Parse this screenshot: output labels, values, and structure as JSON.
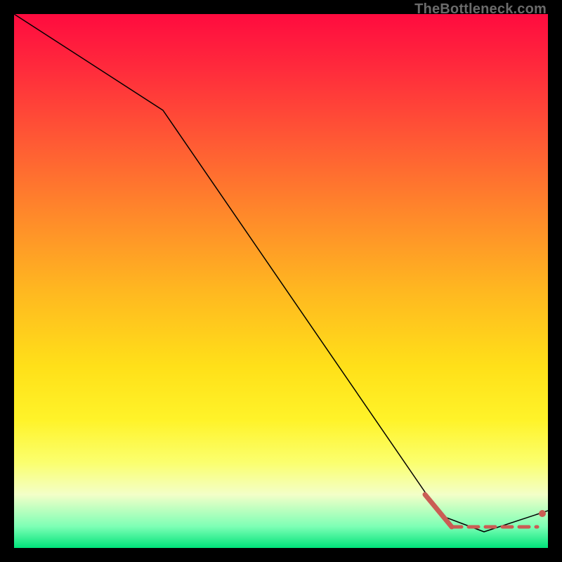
{
  "watermark": "TheBottleneck.com",
  "colors": {
    "line": "#000000",
    "accent": "#ca5d54",
    "gradient_top": "#ff0b3f",
    "gradient_bottom": "#00e37a",
    "frame": "#000000"
  },
  "chart_data": {
    "type": "line",
    "title": "",
    "xlabel": "",
    "ylabel": "",
    "xlim": [
      0,
      100
    ],
    "ylim": [
      0,
      100
    ],
    "grid": false,
    "legend": false,
    "series": [
      {
        "name": "main-curve",
        "x": [
          0,
          28,
          80,
          88,
          100
        ],
        "y": [
          100,
          82,
          6,
          3,
          7
        ],
        "style": "thin-black"
      },
      {
        "name": "highlight-drop",
        "x": [
          77,
          82
        ],
        "y": [
          10,
          4
        ],
        "style": "thick-accent-solid"
      },
      {
        "name": "highlight-flat",
        "x": [
          82,
          98
        ],
        "y": [
          4,
          4
        ],
        "style": "thick-accent-dashed"
      }
    ],
    "points": [
      {
        "name": "end-dot",
        "x": 99,
        "y": 6.5
      }
    ]
  }
}
